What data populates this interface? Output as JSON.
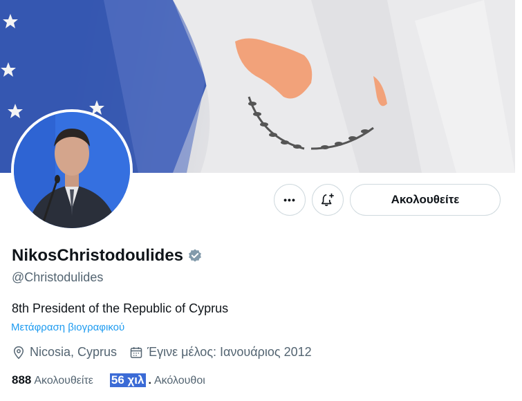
{
  "profile": {
    "display_name": "NikosChristodoulides",
    "handle": "@Christodulides",
    "bio": "8th President of the Republic of Cyprus",
    "translate_bio": "Μετάφραση βιογραφικού",
    "location": "Nicosia, Cyprus",
    "joined": "Έγινε μέλος: Ιανουάριος 2012",
    "verified": true
  },
  "actions": {
    "more_label": "•••",
    "follow_label": "Ακολουθείτε"
  },
  "stats": {
    "following_count": "888",
    "following_label": "Ακολουθείτε",
    "followers_count": "56 χιλ",
    "followers_label": "Ακόλουθοι"
  },
  "colors": {
    "accent": "#1d9bf0",
    "text_primary": "#0f1419",
    "text_secondary": "#536471",
    "border": "#cfd9de",
    "verified_badge": "#829aab"
  },
  "icons": {
    "location": "location-pin-icon",
    "calendar": "calendar-icon",
    "notify": "bell-plus-icon",
    "more": "more-dots-icon",
    "verified": "verified-badge-icon"
  }
}
